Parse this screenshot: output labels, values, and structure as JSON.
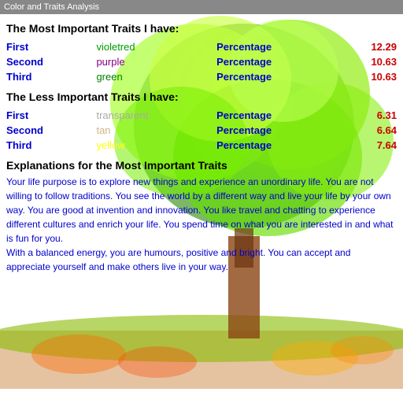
{
  "titleBar": {
    "label": "Color and Traits Analysis"
  },
  "mostImportant": {
    "heading": "The Most Important Traits I have:",
    "rows": [
      {
        "rank": "First",
        "color": "violetred",
        "label": "Percentage",
        "value": "12.29"
      },
      {
        "rank": "Second",
        "color": "purple",
        "label": "Percentage",
        "value": "10.63"
      },
      {
        "rank": "Third",
        "color": "green",
        "label": "Percentage",
        "value": "10.63"
      }
    ]
  },
  "lessImportant": {
    "heading": "The Less Important Traits I have:",
    "rows": [
      {
        "rank": "First",
        "color": "transparent",
        "label": "Percentage",
        "value": "6.31"
      },
      {
        "rank": "Second",
        "color": "tan",
        "label": "Percentage",
        "value": "6.64"
      },
      {
        "rank": "Third",
        "color": "yellow",
        "label": "Percentage",
        "value": "7.64"
      }
    ]
  },
  "explanations": {
    "heading": "Explanations for the Most Important Traits",
    "text": "Your life purpose is to explore new things and experience an unordinary life.  You are not willing to follow traditions.  You see the world by a different way and live your life by your own way.  You are good at invention and innovation.  You like travel and chatting to experience different cultures and enrich your life.  You spend time on what you are interested in and what is fun for you.\nWith a balanced energy, you are humours, positive and bright.  You can accept and appreciate yourself and make others live in your way."
  }
}
